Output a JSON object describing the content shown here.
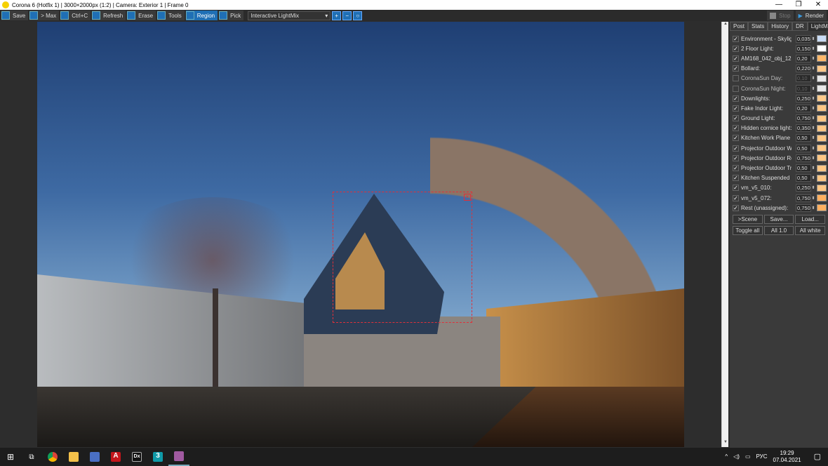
{
  "window": {
    "title": "Corona 6 (Hotfix 1) | 3000×2000px (1:2) | Camera: Exterior 1 | Frame 0",
    "minimize": "—",
    "maximize": "❐",
    "close": "✕"
  },
  "toolbar": {
    "save": "Save",
    "max": "> Max",
    "copy": "Ctrl+C",
    "refresh": "Refresh",
    "erase": "Erase",
    "tools": "Tools",
    "region": "Region",
    "pick": "Pick",
    "mode": "Interactive LightMix",
    "stop": "Stop",
    "render": "Render"
  },
  "panel": {
    "tabs": [
      "Post",
      "Stats",
      "History",
      "DR",
      "LightMix"
    ],
    "lights": [
      {
        "on": true,
        "label": "Environment - Skylight",
        "value": "0,035",
        "color": "#c9dcf5"
      },
      {
        "on": true,
        "label": "2 Floor Light:",
        "value": "0,150",
        "color": "#ffffff"
      },
      {
        "on": true,
        "label": "AM168_042_obj_12:",
        "value": "0,20",
        "color": "#ffb86a"
      },
      {
        "on": true,
        "label": "Bollard:",
        "value": "0,220",
        "color": "#ffc98a"
      },
      {
        "on": false,
        "label": "CoronaSun Day:",
        "value": "0,10",
        "color": "#e8e8e8"
      },
      {
        "on": false,
        "label": "CoronaSun Night:",
        "value": "0,10",
        "color": "#e8e8e8"
      },
      {
        "on": true,
        "label": "Downlights:",
        "value": "0,250",
        "color": "#ffcb8c"
      },
      {
        "on": true,
        "label": "Fake Indor Light:",
        "value": "0,20",
        "color": "#ffc784"
      },
      {
        "on": true,
        "label": "Ground Light:",
        "value": "0,750",
        "color": "#ffc784"
      },
      {
        "on": true,
        "label": "Hidden cornice light:",
        "value": "0,350",
        "color": "#ffc784"
      },
      {
        "on": true,
        "label": "Kitchen Work Plane L",
        "value": "0,50",
        "color": "#ffc784"
      },
      {
        "on": true,
        "label": "Projector Outdoor Wa",
        "value": "0,50",
        "color": "#ffc784"
      },
      {
        "on": true,
        "label": "Projector Outdoor Ro",
        "value": "0,750",
        "color": "#ffc784"
      },
      {
        "on": true,
        "label": "Projector Outdoor Tre",
        "value": "0,50",
        "color": "#ffc784"
      },
      {
        "on": true,
        "label": "Kitchen Suspended Li",
        "value": "0,50",
        "color": "#ffc784"
      },
      {
        "on": true,
        "label": "vm_v5_010:",
        "value": "0,250",
        "color": "#ffc784"
      },
      {
        "on": true,
        "label": "vm_v5_072:",
        "value": "0,750",
        "color": "#ffb060"
      },
      {
        "on": true,
        "label": "Rest (unassigned):",
        "value": "0,750",
        "color": "#ffb060"
      }
    ],
    "buttons_row1": [
      ">Scene",
      "Save...",
      "Load..."
    ],
    "buttons_row2": [
      "Toggle all",
      "All 1.0",
      "All white"
    ]
  },
  "taskbar": {
    "lang": "РУС",
    "time": "19:29",
    "date": "07.04.2021",
    "apps": [
      "start",
      "task-view",
      "chrome",
      "explorer",
      "app",
      "autocad",
      "dx",
      "3dsmax",
      "corona"
    ]
  }
}
